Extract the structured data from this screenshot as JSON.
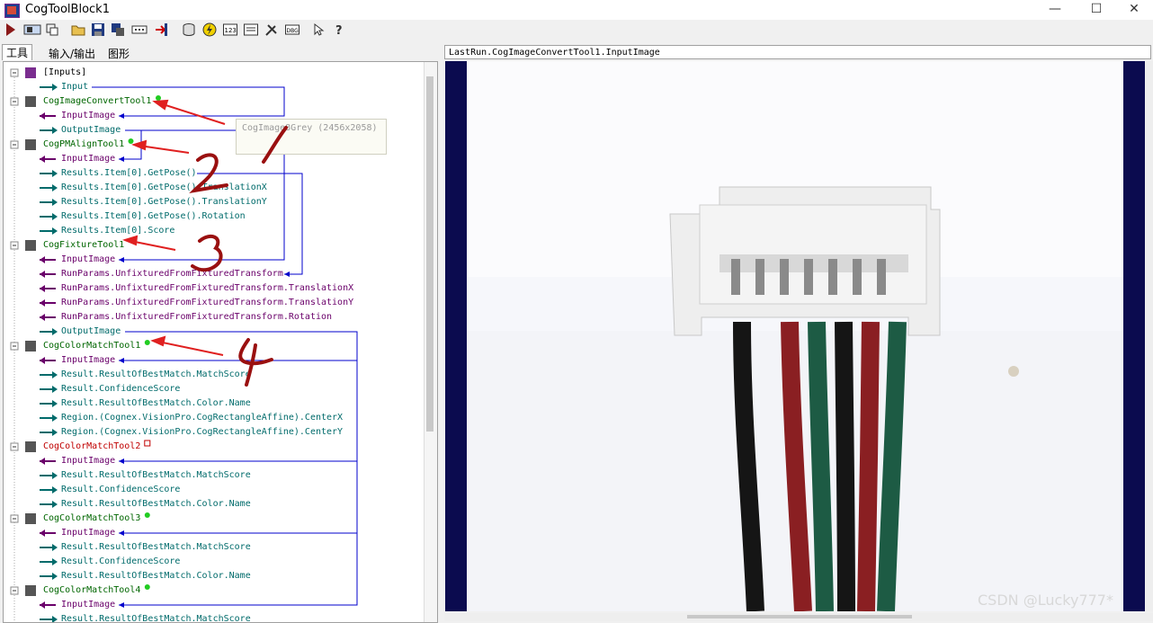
{
  "window": {
    "title": "CogToolBlock1",
    "controls": {
      "minimize": "—",
      "maximize": "☐",
      "close": "✕"
    }
  },
  "toolbar": {
    "icons": [
      "run-icon",
      "show-icon",
      "pin-icon",
      "open-icon",
      "save-icon",
      "save-as-icon",
      "dots-icon",
      "flag-icon",
      "database-icon",
      "lightning-icon",
      "123-icon",
      "image-icon",
      "tools-icon",
      "debug-icon",
      "cursor-icon",
      "help-icon"
    ]
  },
  "tabs": [
    "工具",
    "输入/输出",
    "图形"
  ],
  "tree": {
    "rows": [
      {
        "label": "[Inputs]",
        "kind": "group"
      },
      {
        "label": "Input",
        "kind": "out"
      },
      {
        "label": "CogImageConvertTool1",
        "kind": "tool",
        "status": "ok"
      },
      {
        "label": "InputImage",
        "kind": "in"
      },
      {
        "label": "OutputImage",
        "kind": "out"
      },
      {
        "label": "CogPMAlignTool1",
        "kind": "tool",
        "status": "ok"
      },
      {
        "label": "InputImage",
        "kind": "in"
      },
      {
        "label": "Results.Item[0].GetPose()",
        "kind": "out"
      },
      {
        "label": "Results.Item[0].GetPose().TranslationX",
        "kind": "out"
      },
      {
        "label": "Results.Item[0].GetPose().TranslationY",
        "kind": "out"
      },
      {
        "label": "Results.Item[0].GetPose().Rotation",
        "kind": "out"
      },
      {
        "label": "Results.Item[0].Score",
        "kind": "out"
      },
      {
        "label": "CogFixtureTool1",
        "kind": "tool",
        "status": "none"
      },
      {
        "label": "InputImage",
        "kind": "in"
      },
      {
        "label": "RunParams.UnfixturedFromFixturedTransform",
        "kind": "in"
      },
      {
        "label": "RunParams.UnfixturedFromFixturedTransform.TranslationX",
        "kind": "in"
      },
      {
        "label": "RunParams.UnfixturedFromFixturedTransform.TranslationY",
        "kind": "in"
      },
      {
        "label": "RunParams.UnfixturedFromFixturedTransform.Rotation",
        "kind": "in"
      },
      {
        "label": "OutputImage",
        "kind": "out"
      },
      {
        "label": "CogColorMatchTool1",
        "kind": "tool",
        "status": "ok"
      },
      {
        "label": "InputImage",
        "kind": "in"
      },
      {
        "label": "Result.ResultOfBestMatch.MatchScore",
        "kind": "out"
      },
      {
        "label": "Result.ConfidenceScore",
        "kind": "out"
      },
      {
        "label": "Result.ResultOfBestMatch.Color.Name",
        "kind": "out"
      },
      {
        "label": "Region.(Cognex.VisionPro.CogRectangleAffine).CenterX",
        "kind": "out"
      },
      {
        "label": "Region.(Cognex.VisionPro.CogRectangleAffine).CenterY",
        "kind": "out"
      },
      {
        "label": "CogColorMatchTool2",
        "kind": "tool",
        "status": "error"
      },
      {
        "label": "InputImage",
        "kind": "in"
      },
      {
        "label": "Result.ResultOfBestMatch.MatchScore",
        "kind": "out"
      },
      {
        "label": "Result.ConfidenceScore",
        "kind": "out"
      },
      {
        "label": "Result.ResultOfBestMatch.Color.Name",
        "kind": "out"
      },
      {
        "label": "CogColorMatchTool3",
        "kind": "tool",
        "status": "ok"
      },
      {
        "label": "InputImage",
        "kind": "in"
      },
      {
        "label": "Result.ResultOfBestMatch.MatchScore",
        "kind": "out"
      },
      {
        "label": "Result.ConfidenceScore",
        "kind": "out"
      },
      {
        "label": "Result.ResultOfBestMatch.Color.Name",
        "kind": "out"
      },
      {
        "label": "CogColorMatchTool4",
        "kind": "tool",
        "status": "ok"
      },
      {
        "label": "InputImage",
        "kind": "in"
      },
      {
        "label": "Result.ResultOfBestMatch.MatchScore",
        "kind": "out"
      }
    ]
  },
  "tooltip": "CogImage8Grey (2456x2058)",
  "image_panel": {
    "header": "LastRun.CogImageConvertTool1.InputImage"
  },
  "annotations": [
    "1",
    "2",
    "3",
    "4"
  ],
  "watermark": "CSDN @Lucky777*",
  "colors": {
    "tool_ok": "#006600",
    "tool_error": "#c00000",
    "terminal_in": "#6a006a",
    "terminal_out": "#006b6b",
    "link": "#0000cc",
    "annotation": "#e02020",
    "image_border": "#0b0b4f"
  }
}
